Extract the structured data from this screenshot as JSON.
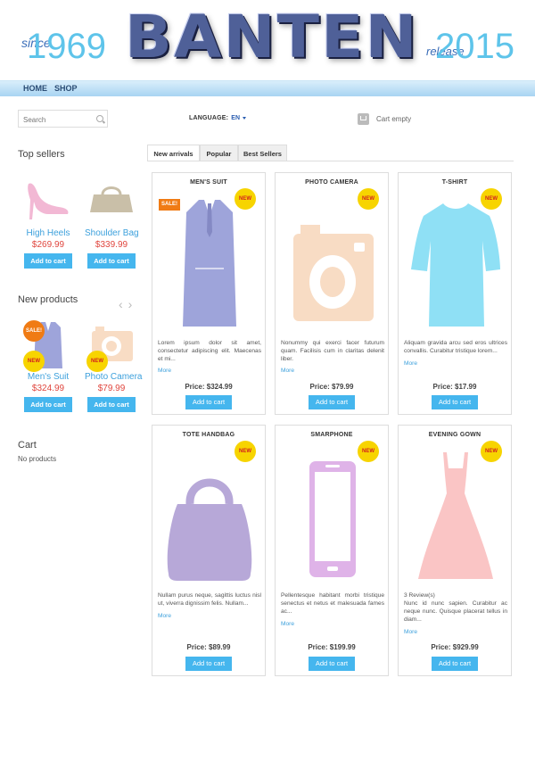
{
  "header": {
    "since_label": "since",
    "since_year": "1969",
    "logo_text": "BANTEN",
    "release_label": "release",
    "release_year": "2015"
  },
  "nav": {
    "items": [
      "HOME",
      "SHOP"
    ]
  },
  "search": {
    "placeholder": "Search"
  },
  "language": {
    "label": "LANGUAGE:",
    "value": "EN"
  },
  "cart_top": {
    "label": "Cart empty"
  },
  "sidebar": {
    "top_sellers_title": "Top sellers",
    "top_sellers": [
      {
        "name": "High Heels",
        "price": "$269.99",
        "button": "Add to cart",
        "icon": "high-heel-icon",
        "color": "#f2b8d4"
      },
      {
        "name": "Shoulder Bag",
        "price": "$339.99",
        "button": "Add to cart",
        "icon": "handbag-icon",
        "color": "#c9bfa8"
      }
    ],
    "new_products_title": "New products",
    "new_products": [
      {
        "name": "Men's Suit",
        "price": "$324.99",
        "button": "Add to cart",
        "icon": "suit-icon",
        "color": "#9ea4da",
        "sale_badge": "SALE!",
        "new_badge": "NEW"
      },
      {
        "name": "Photo Camera",
        "price": "$79.99",
        "button": "Add to cart",
        "icon": "camera-icon",
        "color": "#f8dcc4",
        "new_badge": "NEW"
      }
    ],
    "cart_title": "Cart",
    "cart_empty": "No products"
  },
  "tabs": [
    "New arrivals",
    "Popular",
    "Best Sellers"
  ],
  "products": [
    {
      "title": "MEN'S SUIT",
      "badge": "NEW",
      "sale": "SALE!",
      "icon": "suit-icon",
      "color": "#9ea4da",
      "desc": "Lorem ipsum dolor sit amet, consectetur adipiscing elit. Maecenas et mi...",
      "reviews": "",
      "more": "More",
      "price": "Price: $324.99",
      "button": "Add to cart"
    },
    {
      "title": "PHOTO CAMERA",
      "badge": "NEW",
      "sale": "",
      "icon": "camera-icon",
      "color": "#f8dcc4",
      "desc": "Nonummy qui exerci facer futurum quam. Facilisis cum in claritas delenit liber.",
      "reviews": "",
      "more": "More",
      "price": "Price: $79.99",
      "button": "Add to cart"
    },
    {
      "title": "T-SHIRT",
      "badge": "NEW",
      "sale": "",
      "icon": "tshirt-icon",
      "color": "#8fe0f5",
      "desc": "Aliquam gravida arcu sed eros ultrices convallis. Curabitur tristique lorem...",
      "reviews": "",
      "more": "More",
      "price": "Price: $17.99",
      "button": "Add to cart"
    },
    {
      "title": "TOTE HANDBAG",
      "badge": "NEW",
      "sale": "",
      "icon": "handbag-icon",
      "color": "#b7a8d8",
      "desc": "Nullam purus neque, sagittis luctus nisl ut, viverra dignissim felis. Nullam...",
      "reviews": "",
      "more": "More",
      "price": "Price: $89.99",
      "button": "Add to cart"
    },
    {
      "title": "SMARPHONE",
      "badge": "NEW",
      "sale": "",
      "icon": "smartphone-icon",
      "color": "#dfb3e8",
      "desc": "Pellentesque habitant morbi tristique senectus et netus et malesuada fames ac...",
      "reviews": "",
      "more": "More",
      "price": "Price: $199.99",
      "button": "Add to cart"
    },
    {
      "title": "EVENING GOWN",
      "badge": "NEW",
      "sale": "",
      "icon": "gown-icon",
      "color": "#fac5c5",
      "desc": "Nunc id nunc sapien. Curabitur ac neque nunc. Quisque placerat tellus in diam...",
      "reviews": "3 Review(s)",
      "more": "More",
      "price": "Price: $929.99",
      "button": "Add to cart"
    }
  ],
  "colors": {
    "accent": "#45b6ee",
    "price_red": "#e0463e",
    "link": "#3ca0dc",
    "badge_yellow": "#f7d400",
    "sale_orange": "#f07b14"
  }
}
